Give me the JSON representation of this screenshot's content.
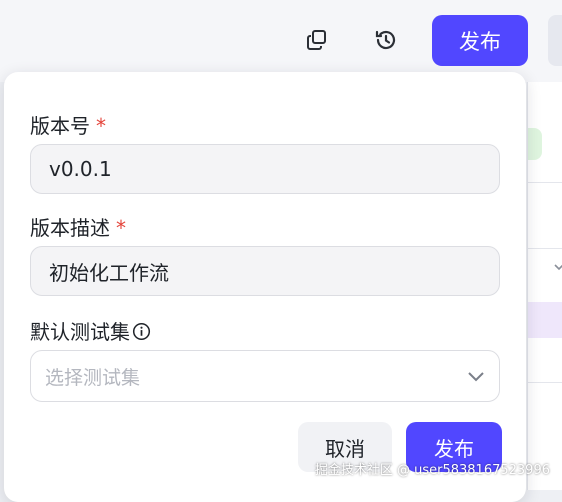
{
  "toolbar": {
    "copy_icon": "copy-icon",
    "history_icon": "history-icon",
    "publish_label": "发布"
  },
  "form": {
    "version_label": "版本号",
    "version_value": "v0.0.1",
    "desc_label": "版本描述",
    "desc_value": "初始化工作流",
    "required_mark": "*",
    "testset_label": "默认测试集",
    "testset_placeholder": "选择测试集",
    "cancel_label": "取消",
    "submit_label": "发布"
  },
  "watermark": "掘金技术社区 @ user5838167523996",
  "colors": {
    "accent": "#5147ff",
    "required": "#e4443a",
    "placeholder": "#b4b7bf"
  }
}
